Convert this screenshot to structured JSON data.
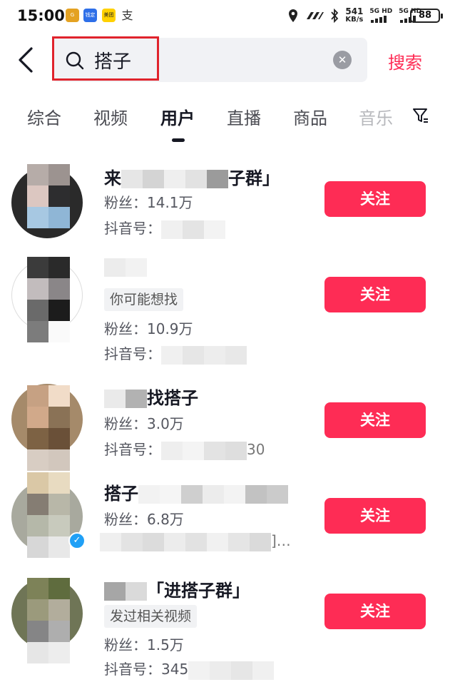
{
  "status_bar": {
    "time": "15:00",
    "app_icons": [
      "G",
      "钱定",
      "美团",
      "支"
    ],
    "net_speed": "541",
    "net_unit": "KB/s",
    "signal1": "5G HD",
    "signal2": "5G HD",
    "battery": "88"
  },
  "search": {
    "query": "搭子",
    "submit_label": "搜索"
  },
  "tabs": [
    {
      "label": "综合"
    },
    {
      "label": "视频"
    },
    {
      "label": "用户"
    },
    {
      "label": "直播"
    },
    {
      "label": "商品"
    },
    {
      "label": "音乐"
    }
  ],
  "users": [
    {
      "name_prefix": "来",
      "name_suffix": "子群」",
      "tag": "",
      "fans_label": "粉丝：",
      "fans": "14.1万",
      "id_label": "抖音号：",
      "id_value": "",
      "follow": "关注",
      "verified": false
    },
    {
      "name_prefix": "",
      "name_suffix": "",
      "tag": "你可能想找",
      "fans_label": "粉丝：",
      "fans": "10.9万",
      "id_label": "抖音号：",
      "id_value": "",
      "follow": "关注",
      "verified": false
    },
    {
      "name_prefix": "",
      "name_suffix": "找搭子",
      "tag": "",
      "fans_label": "粉丝：",
      "fans": "3.0万",
      "id_label": "抖音号：",
      "id_value": "30",
      "follow": "关注",
      "verified": false
    },
    {
      "name_prefix": "搭子",
      "name_suffix": "",
      "tag": "",
      "fans_label": "粉丝：",
      "fans": "6.8万",
      "id_label": "",
      "id_value": "]…",
      "follow": "关注",
      "verified": true
    },
    {
      "name_prefix": "",
      "name_suffix": "「进搭子群」",
      "tag": "发过相关视频",
      "fans_label": "粉丝：",
      "fans": "1.5万",
      "id_label": "抖音号：",
      "id_value": "345",
      "follow": "关注",
      "verified": false
    }
  ],
  "colors": {
    "accent": "#fe2c55",
    "highlight_box": "#e0232c",
    "verified": "#20a0f6"
  }
}
